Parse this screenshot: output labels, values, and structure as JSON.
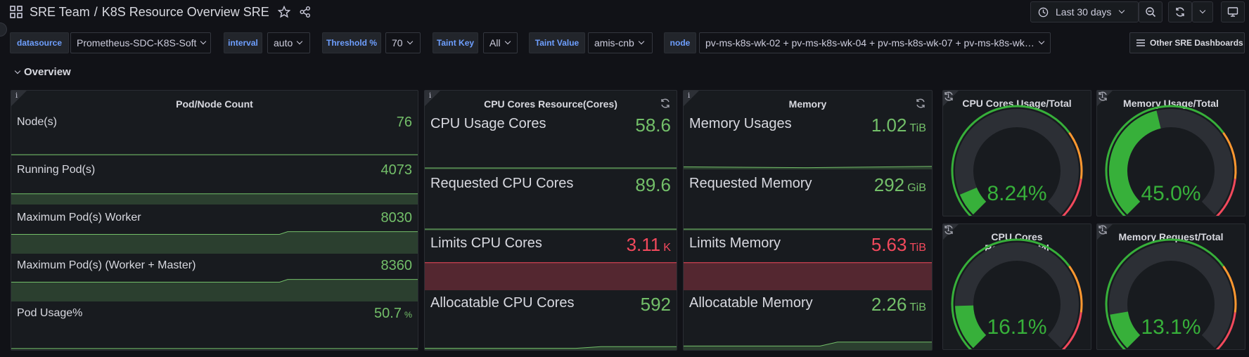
{
  "breadcrumb": {
    "team": "SRE Team",
    "dashboard": "K8S Resource Overview SRE"
  },
  "toolbar": {
    "time_range": "Last 30 days"
  },
  "variables": [
    {
      "label": "datasource",
      "value": "Prometheus-SDC-K8S-Soft"
    },
    {
      "label": "interval",
      "value": "auto"
    },
    {
      "label": "Threshold %",
      "value": "70"
    },
    {
      "label": "Taint Key",
      "value": "All"
    },
    {
      "label": "Taint Value",
      "value": "amis-cnb"
    },
    {
      "label": "node",
      "value": "pv-ms-k8s-wk-02 + pv-ms-k8s-wk-04 + pv-ms-k8s-wk-07 + pv-ms-k8s-wk…"
    }
  ],
  "other_dashboards": "Other SRE Dashboards",
  "row_title": "Overview",
  "panels": {
    "pod_node": {
      "title": "Pod/Node Count",
      "stats": [
        {
          "label": "Node(s)",
          "value": "76",
          "unit": ""
        },
        {
          "label": "Running Pod(s)",
          "value": "4073",
          "unit": ""
        },
        {
          "label": "Maximum Pod(s) Worker",
          "value": "8030",
          "unit": ""
        },
        {
          "label": "Maximum Pod(s) (Worker + Master)",
          "value": "8360",
          "unit": ""
        },
        {
          "label": "Pod Usage%",
          "value": "50.7",
          "unit": "%"
        }
      ]
    },
    "cpu": {
      "title": "CPU Cores Resource(Cores)",
      "stats": [
        {
          "label": "CPU Usage Cores",
          "value": "58.6",
          "unit": ""
        },
        {
          "label": "Requested CPU Cores",
          "value": "89.6",
          "unit": ""
        },
        {
          "label": "Limits CPU Cores",
          "value": "3.11",
          "unit": "K"
        },
        {
          "label": "Allocatable CPU Cores",
          "value": "592",
          "unit": ""
        }
      ]
    },
    "memory": {
      "title": "Memory",
      "stats": [
        {
          "label": "Memory Usages",
          "value": "1.02",
          "unit": "TiB"
        },
        {
          "label": "Requested Memory",
          "value": "292",
          "unit": "GiB"
        },
        {
          "label": "Limits Memory",
          "value": "5.63",
          "unit": "TiB"
        },
        {
          "label": "Allocatable Memory",
          "value": "2.26",
          "unit": "TiB"
        }
      ]
    },
    "gauges": [
      {
        "title": "CPU Cores Usage/Total",
        "value": "8.24%",
        "percent": 8.24
      },
      {
        "title": "Memory Usage/Total",
        "value": "45.0%",
        "percent": 45.0
      },
      {
        "title": "CPU Cores Request/Total",
        "value": "16.1%",
        "percent": 16.1
      },
      {
        "title": "Memory Request/Total",
        "value": "13.1%",
        "percent": 13.1
      }
    ]
  },
  "colors": {
    "green": "#73bf69",
    "red": "#f2495c",
    "orange": "#ff9830",
    "gauge_green": "#37b03a",
    "blue_label": "#6e9fff"
  }
}
